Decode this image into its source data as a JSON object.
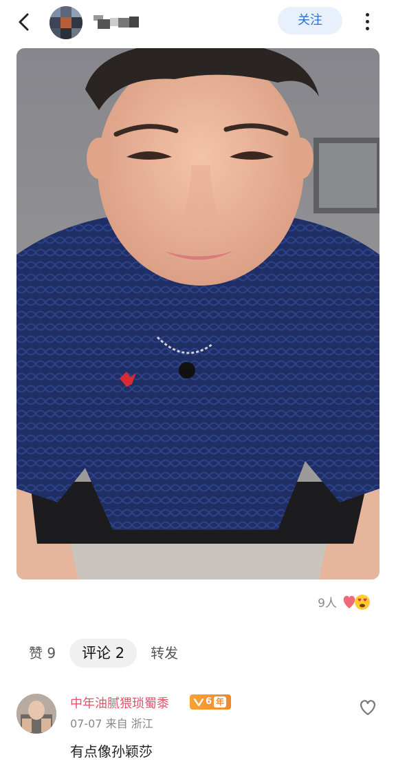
{
  "header": {
    "follow_label": "关注",
    "icons": [
      "back-arrow-icon",
      "more-vertical-icon"
    ]
  },
  "post": {
    "reaction_count": "9人",
    "reaction_icons": [
      "heart-emoji",
      "heart-eyes-emoji"
    ]
  },
  "tabs": [
    {
      "label": "赞 9",
      "active": false
    },
    {
      "label": "评论 2",
      "active": true
    },
    {
      "label": "转发",
      "active": false
    }
  ],
  "comment": {
    "username": "中年油腻猥琐蜀黍",
    "badge_level": "6",
    "badge_unit": "年",
    "meta": "07-07 来自 浙江",
    "text": "有点像孙颖莎",
    "name_color": "#e0546a"
  },
  "colors": {
    "accent": "#2a6fd6",
    "follow_bg": "#e8f0fb",
    "badge": "#f3882b"
  }
}
